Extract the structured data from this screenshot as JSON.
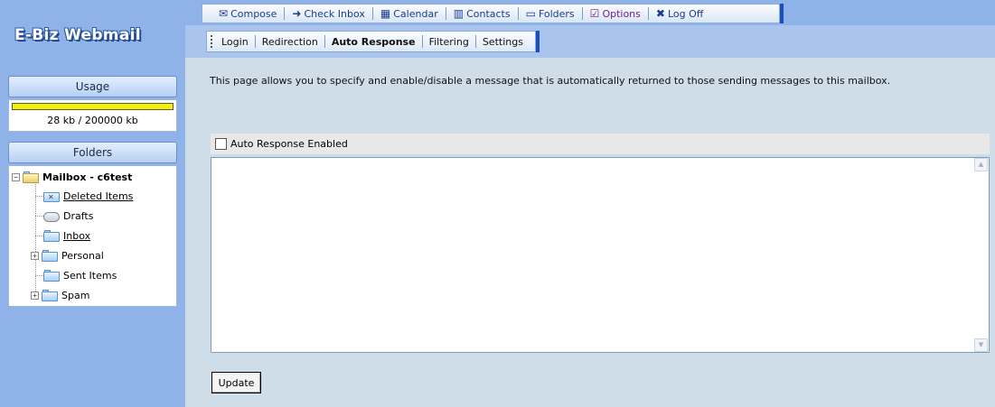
{
  "app": {
    "title": "E-Biz Webmail"
  },
  "toolbar": {
    "items": [
      {
        "label": "Compose",
        "icon": "compose-icon"
      },
      {
        "label": "Check Inbox",
        "icon": "check-inbox-icon"
      },
      {
        "label": "Calendar",
        "icon": "calendar-icon"
      },
      {
        "label": "Contacts",
        "icon": "contacts-icon"
      },
      {
        "label": "Folders",
        "icon": "folder-icon"
      },
      {
        "label": "Options",
        "icon": "options-check-icon"
      },
      {
        "label": "Log Off",
        "icon": "log-off-icon"
      }
    ]
  },
  "subtabs": {
    "items": [
      "Login",
      "Redirection",
      "Auto Response",
      "Filtering",
      "Settings"
    ],
    "active": "Auto Response"
  },
  "usage": {
    "title": "Usage",
    "text": "28 kb / 200000 kb",
    "fraction": 1.0,
    "bar_color": "#f5f000"
  },
  "folders": {
    "title": "Folders",
    "root": "Mailbox - c6test",
    "items": [
      {
        "label": "Deleted Items",
        "icon": "deleted-items-icon",
        "link": true
      },
      {
        "label": "Drafts",
        "icon": "drafts-icon",
        "link": false
      },
      {
        "label": "Inbox",
        "icon": "inbox-folder-icon",
        "link": true
      },
      {
        "label": "Personal",
        "icon": "folder-icon",
        "link": false
      },
      {
        "label": "Sent Items",
        "icon": "folder-icon",
        "link": false
      },
      {
        "label": "Spam",
        "icon": "folder-icon",
        "link": false
      }
    ]
  },
  "main": {
    "description": "This page allows you to specify and enable/disable a message that is automatically returned to those sending messages to this mailbox.",
    "checkbox_label": "Auto Response Enabled",
    "checkbox_checked": false,
    "message_value": "",
    "update_label": "Update"
  }
}
